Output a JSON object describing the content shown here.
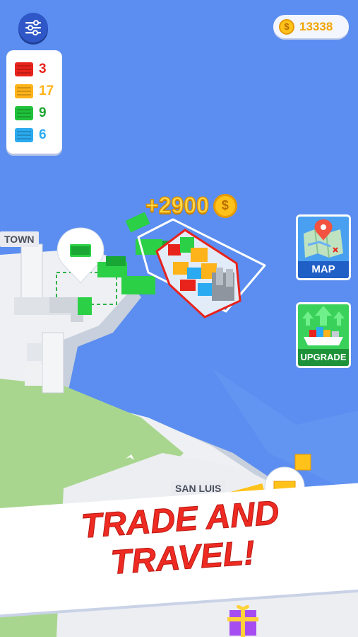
{
  "hud": {
    "coins": "13338",
    "coin_symbol": "$"
  },
  "cargo": [
    {
      "color_name": "red",
      "color": "#e8231b",
      "count": "3"
    },
    {
      "color_name": "orange",
      "color": "#ffb31a",
      "count": "17"
    },
    {
      "color_name": "green",
      "color": "#1fc23a",
      "count": "9"
    },
    {
      "color_name": "blue",
      "color": "#2aaaf0",
      "count": "6"
    }
  ],
  "buttons": {
    "map_label": "MAP",
    "upgrade_label": "UPGRADE"
  },
  "world": {
    "reward_text": "+2900",
    "reward_coin_symbol": "$",
    "town_label": "TOWN",
    "port_label": "SAN LUIS"
  },
  "banner": {
    "line1": "TRADE AND",
    "line2": "TRAVEL!"
  }
}
